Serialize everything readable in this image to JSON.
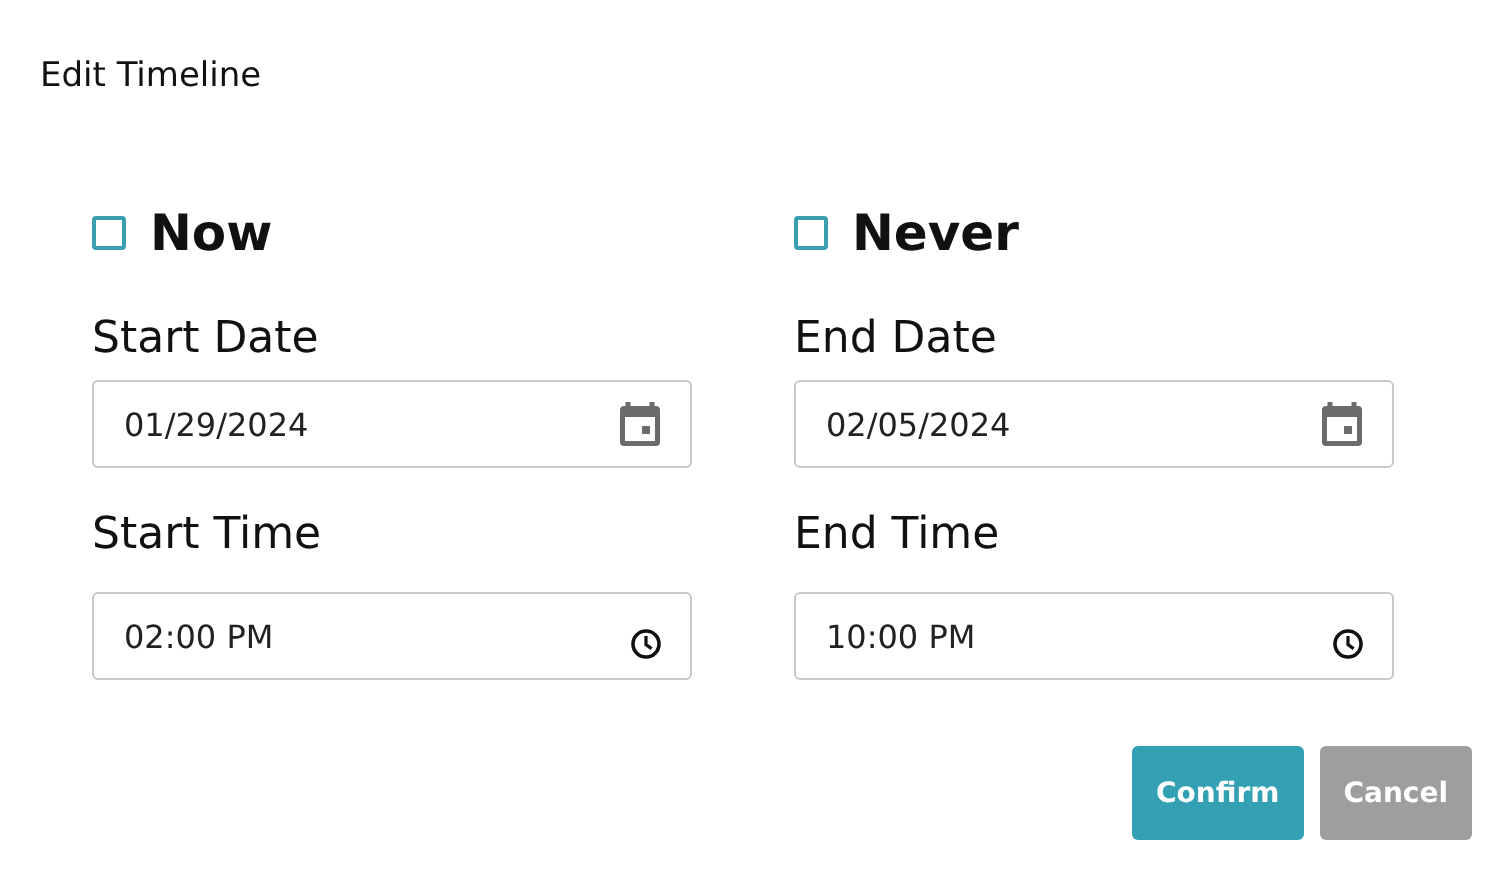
{
  "dialog": {
    "title": "Edit Timeline"
  },
  "columns": [
    {
      "checkbox": {
        "label": "Now",
        "checked": false
      },
      "date": {
        "label": "Start Date",
        "value": "01/29/2024"
      },
      "time": {
        "label": "Start Time",
        "value": "02:00 PM"
      }
    },
    {
      "checkbox": {
        "label": "Never",
        "checked": false
      },
      "date": {
        "label": "End Date",
        "value": "02/05/2024"
      },
      "time": {
        "label": "End Time",
        "value": "10:00 PM"
      }
    }
  ],
  "buttons": [
    {
      "label": "Confirm",
      "kind": "primary"
    },
    {
      "label": "Cancel",
      "kind": "secondary"
    }
  ]
}
